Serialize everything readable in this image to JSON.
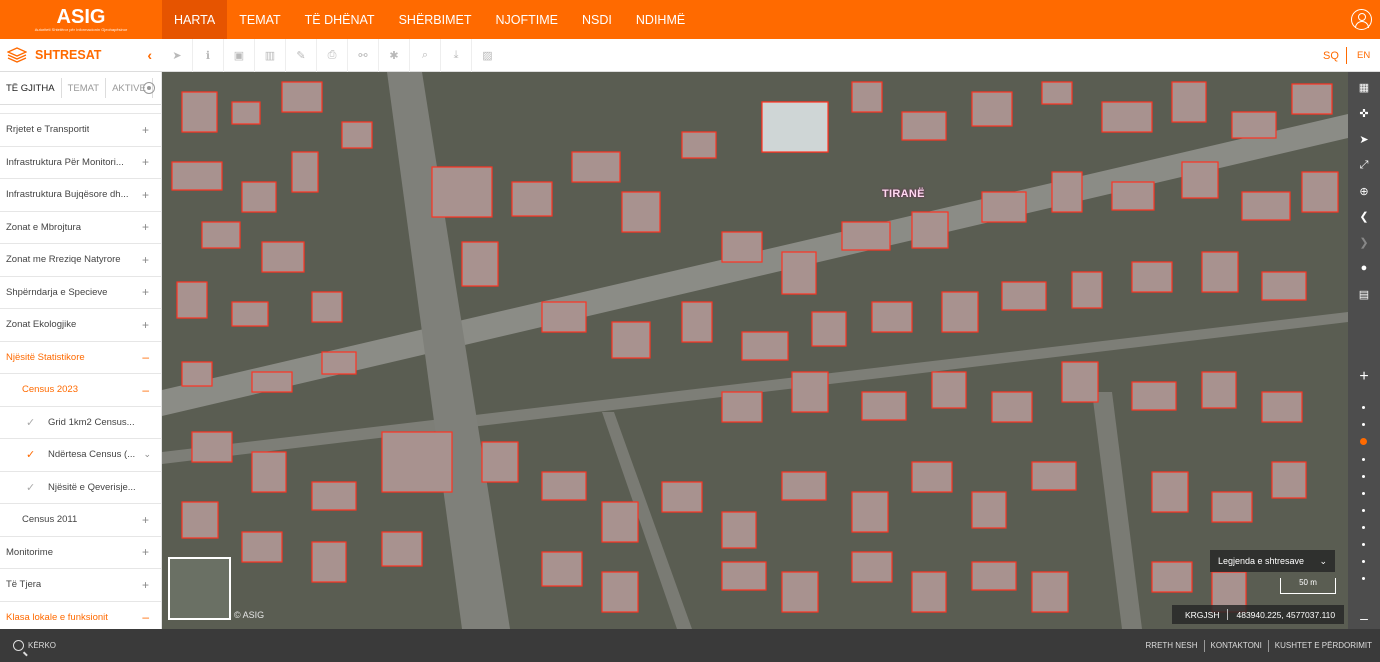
{
  "logo": {
    "text": "ASIG",
    "subtitle": "Autoriteti Shtetëror për Informacionin Gjeohapësinor"
  },
  "nav": [
    "HARTA",
    "TEMAT",
    "TË DHËNAT",
    "SHËRBIMET",
    "NJOFTIME",
    "NSDI",
    "NDIHMË"
  ],
  "toolbar": {
    "title": "SHTRESAT",
    "collapse": "‹"
  },
  "lang": {
    "sq": "SQ",
    "en": "EN"
  },
  "tabs": [
    "TË GJITHA",
    "TEMAT",
    "AKTIVE"
  ],
  "layers": [
    {
      "label": "Rrjetet e Transportit",
      "sign": "+"
    },
    {
      "label": "Infrastruktura Për Monitori...",
      "sign": "+"
    },
    {
      "label": "Infrastruktura Bujqësore dh...",
      "sign": "+"
    },
    {
      "label": "Zonat e Mbrojtura",
      "sign": "+"
    },
    {
      "label": "Zonat me Rreziqe Natyrore",
      "sign": "+"
    },
    {
      "label": "Shpërndarja e Specieve",
      "sign": "+"
    },
    {
      "label": "Zonat Ekologjike",
      "sign": "+"
    },
    {
      "label": "Njësitë Statistikore",
      "sign": "–"
    },
    {
      "label": "Census 2023",
      "sign": "–"
    },
    {
      "label": "Grid 1km2 Census...",
      "sign": ""
    },
    {
      "label": "Ndërtesa Census (...",
      "sign": ""
    },
    {
      "label": "Njësitë e Qeverisje...",
      "sign": ""
    },
    {
      "label": "Census 2011",
      "sign": "+"
    },
    {
      "label": "Monitorime",
      "sign": "+"
    },
    {
      "label": "Të Tjera",
      "sign": "+"
    },
    {
      "label": "Klasa lokale e funksionit",
      "sign": "–"
    }
  ],
  "map": {
    "city_label": "TIRANË",
    "copyright": "© ASIG",
    "legend_select": "Legjenda e shtresave",
    "scale": "50 m",
    "crs": "KRGJSH",
    "coordinates": "483940.225, 4577037.110"
  },
  "footer": {
    "search": "KËRKO",
    "links": [
      "RRETH NESH",
      "KONTAKTONI",
      "KUSHTET E PËRDORIMIT"
    ]
  },
  "colors": {
    "accent": "#ff6a00",
    "footer": "#3a3a3a",
    "rightbar": "#4d4d4d"
  }
}
